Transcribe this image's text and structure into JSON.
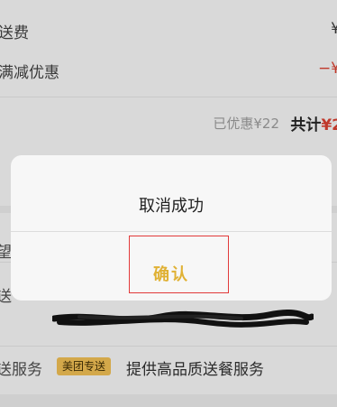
{
  "order": {
    "delivery_fee_label": "送费",
    "delivery_fee_value": "¥",
    "discount_label": "满减优惠",
    "discount_value": "−¥",
    "saved_text": "已优惠¥22",
    "total_label": "共计",
    "total_amount": "¥2"
  },
  "behind_rows": {
    "row1_label": "望",
    "row2_label": "送"
  },
  "service": {
    "label": "送服务",
    "badge": "美团专送",
    "text": "提供高品质送餐服务"
  },
  "dialog": {
    "message": "取消成功",
    "confirm_label": "确认"
  },
  "colors": {
    "overlay": "#d9d9d9",
    "dialog_bg": "#f7f7f7",
    "confirm_text": "#e0b134",
    "price_red": "#c0392b",
    "badge_bg": "#d3a84a",
    "highlight_border": "#e23a3a"
  }
}
